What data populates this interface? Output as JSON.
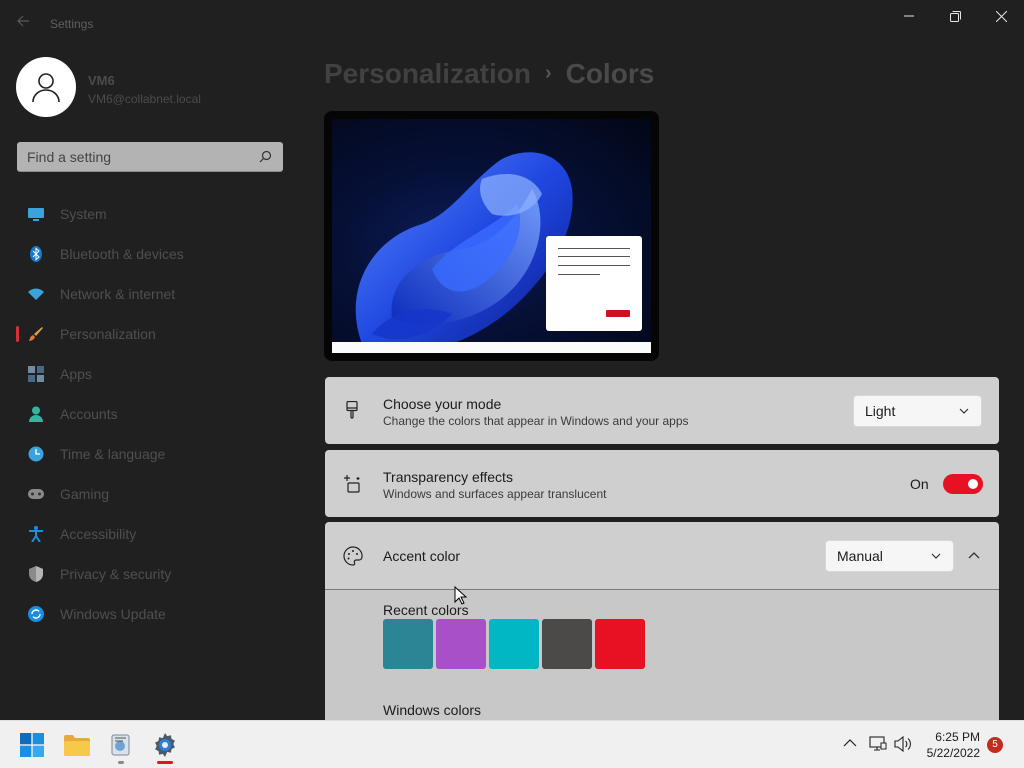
{
  "window": {
    "title": "Settings",
    "controls": [
      "minimize",
      "maximize",
      "close"
    ]
  },
  "user": {
    "name": "VM6",
    "email": "VM6@collabnet.local"
  },
  "search": {
    "placeholder": "Find a setting"
  },
  "sidebar": {
    "items": [
      {
        "label": "System",
        "icon": "monitor-icon",
        "selected": false
      },
      {
        "label": "Bluetooth & devices",
        "icon": "bluetooth-icon",
        "selected": false
      },
      {
        "label": "Network & internet",
        "icon": "wifi-icon",
        "selected": false
      },
      {
        "label": "Personalization",
        "icon": "brush-icon",
        "selected": true
      },
      {
        "label": "Apps",
        "icon": "apps-icon",
        "selected": false
      },
      {
        "label": "Accounts",
        "icon": "person-icon",
        "selected": false
      },
      {
        "label": "Time & language",
        "icon": "clock-globe-icon",
        "selected": false
      },
      {
        "label": "Gaming",
        "icon": "gamepad-icon",
        "selected": false
      },
      {
        "label": "Accessibility",
        "icon": "accessibility-icon",
        "selected": false
      },
      {
        "label": "Privacy & security",
        "icon": "shield-icon",
        "selected": false
      },
      {
        "label": "Windows Update",
        "icon": "update-icon",
        "selected": false
      }
    ]
  },
  "breadcrumb": {
    "parent": "Personalization",
    "separator": "›",
    "current": "Colors"
  },
  "settings": {
    "mode": {
      "title": "Choose your mode",
      "subtitle": "Change the colors that appear in Windows and your apps",
      "value": "Light"
    },
    "transparency": {
      "title": "Transparency effects",
      "subtitle": "Windows and surfaces appear translucent",
      "state_label": "On",
      "enabled": true
    },
    "accent": {
      "title": "Accent color",
      "value": "Manual",
      "expanded": true,
      "recent_label": "Recent colors",
      "recent_colors": [
        "#2b8594",
        "#a850c7",
        "#00b7c3",
        "#4c4a48",
        "#e81123"
      ],
      "windows_label": "Windows colors"
    }
  },
  "taskbar": {
    "apps": [
      "start-icon",
      "file-explorer-icon",
      "utility-app-icon",
      "settings-icon"
    ],
    "time": "6:25 PM",
    "date": "5/22/2022",
    "notification_count": "5"
  },
  "colors": {
    "accent_red": "#e81123",
    "card_bg": "#cfcfcf",
    "sidebar_bg": "#202020"
  }
}
